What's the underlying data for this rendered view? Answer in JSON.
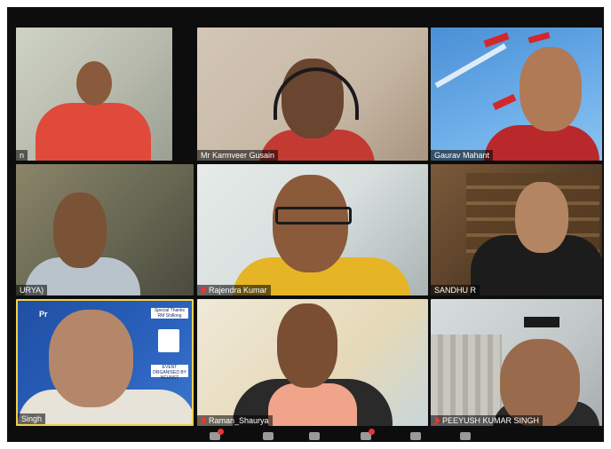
{
  "participants": [
    {
      "name": "n"
    },
    {
      "name": "Mr Karmveer Gusain"
    },
    {
      "name": "Gaurav Mahant"
    },
    {
      "name": "URYA)"
    },
    {
      "name": "Rajendra Kumar",
      "muted": true
    },
    {
      "name": "SANDHU R"
    },
    {
      "name": "Singh"
    },
    {
      "name": "Raman_Shaurya",
      "muted": true
    },
    {
      "name": "PEEYUSH KUMAR SINGH",
      "muted": true
    }
  ],
  "banner": {
    "title": "Pr",
    "thanks": "Special Thanks RM Shillong",
    "organiser": "EVENT ORGANISED BY NEUNST"
  },
  "toolbar": {
    "icons": [
      "participants-icon",
      "share-screen-icon",
      "chat-icon",
      "reactions-icon",
      "record-icon",
      "more-icon"
    ]
  },
  "colors": {
    "background": "#0d0d0d",
    "namebar": "#000000",
    "muted": "#e33333",
    "active_border": "#f0d24a"
  }
}
